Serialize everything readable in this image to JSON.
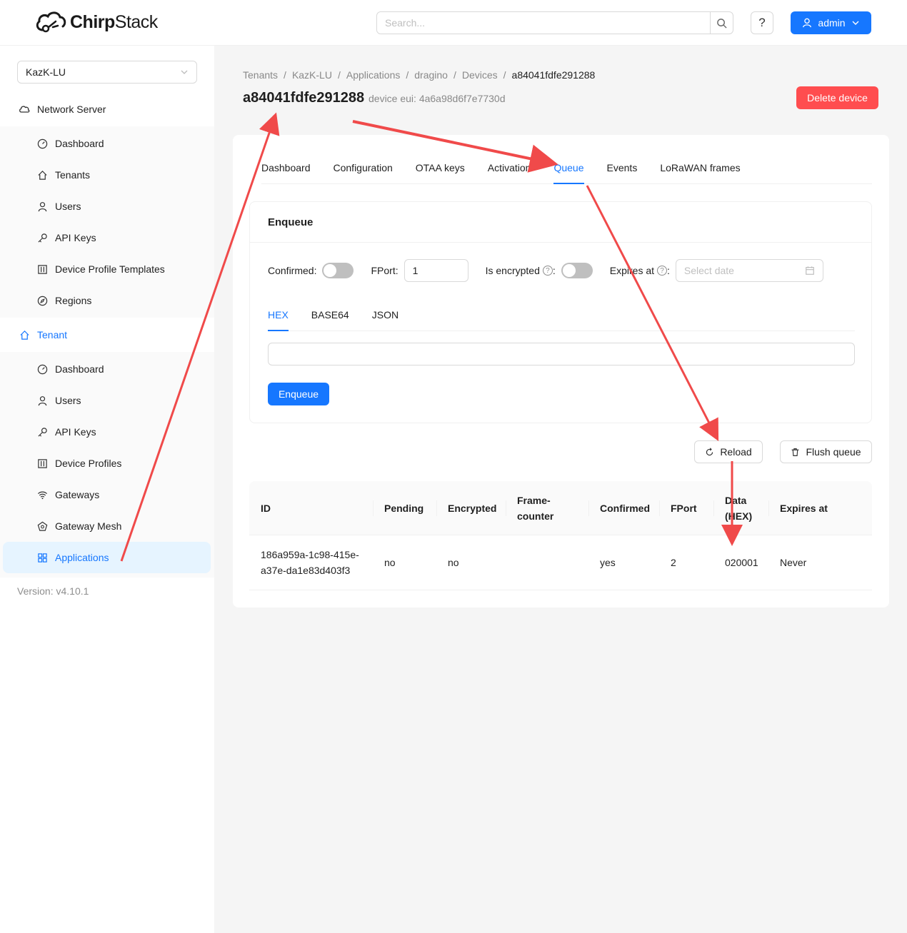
{
  "header": {
    "logo_text_bold": "Chirp",
    "logo_text_light": "Stack",
    "search_placeholder": "Search...",
    "help_label": "?",
    "user_label": "admin"
  },
  "sidebar": {
    "tenant_select": "KazK-LU",
    "network_server_label": "Network Server",
    "network_server_items": [
      {
        "label": "Dashboard",
        "icon": "dashboard-icon"
      },
      {
        "label": "Tenants",
        "icon": "home-icon"
      },
      {
        "label": "Users",
        "icon": "user-icon"
      },
      {
        "label": "API Keys",
        "icon": "key-icon"
      },
      {
        "label": "Device Profile Templates",
        "icon": "control-icon"
      },
      {
        "label": "Regions",
        "icon": "compass-icon"
      }
    ],
    "tenant_label": "Tenant",
    "tenant_items": [
      {
        "label": "Dashboard",
        "icon": "dashboard-icon"
      },
      {
        "label": "Users",
        "icon": "user-icon"
      },
      {
        "label": "API Keys",
        "icon": "key-icon"
      },
      {
        "label": "Device Profiles",
        "icon": "control-icon"
      },
      {
        "label": "Gateways",
        "icon": "wifi-icon"
      },
      {
        "label": "Gateway Mesh",
        "icon": "mesh-icon"
      },
      {
        "label": "Applications",
        "icon": "appstore-icon"
      }
    ],
    "version": "Version: v4.10.1"
  },
  "breadcrumb": [
    "Tenants",
    "KazK-LU",
    "Applications",
    "dragino",
    "Devices",
    "a84041fdfe291288"
  ],
  "page": {
    "title": "a84041fdfe291288",
    "subtitle": "device eui: 4a6a98d6f7e7730d",
    "delete_label": "Delete device"
  },
  "tabs": [
    "Dashboard",
    "Configuration",
    "OTAA keys",
    "Activation",
    "Queue",
    "Events",
    "LoRaWAN frames"
  ],
  "enqueue": {
    "title": "Enqueue",
    "confirmed_label": "Confirmed",
    "fport_label": "FPort",
    "fport_value": "1",
    "encrypted_label": "Is encrypted",
    "expires_label": "Expires at",
    "date_placeholder": "Select date",
    "subtabs": [
      "HEX",
      "BASE64",
      "JSON"
    ],
    "button_label": "Enqueue"
  },
  "queue_actions": {
    "reload_label": "Reload",
    "flush_label": "Flush queue"
  },
  "queue_table": {
    "headers": {
      "id": "ID",
      "pending": "Pending",
      "encrypted": "Encrypted",
      "fcnt_1": "Frame-",
      "fcnt_2": "counter",
      "confirmed": "Confirmed",
      "fport": "FPort",
      "data_1": "Data",
      "data_2": "(HEX)",
      "expires": "Expires at"
    },
    "rows": [
      {
        "id_1": "186a959a-1c98-415e-",
        "id_2": "a37e-da1e83d403f3",
        "pending": "no",
        "encrypted": "no",
        "fcnt": "",
        "confirmed": "yes",
        "fport": "2",
        "data": "020001",
        "expires": "Never"
      }
    ]
  },
  "colors": {
    "primary": "#1677ff",
    "danger": "#ff4d4f",
    "annotation": "#f04a4a"
  }
}
